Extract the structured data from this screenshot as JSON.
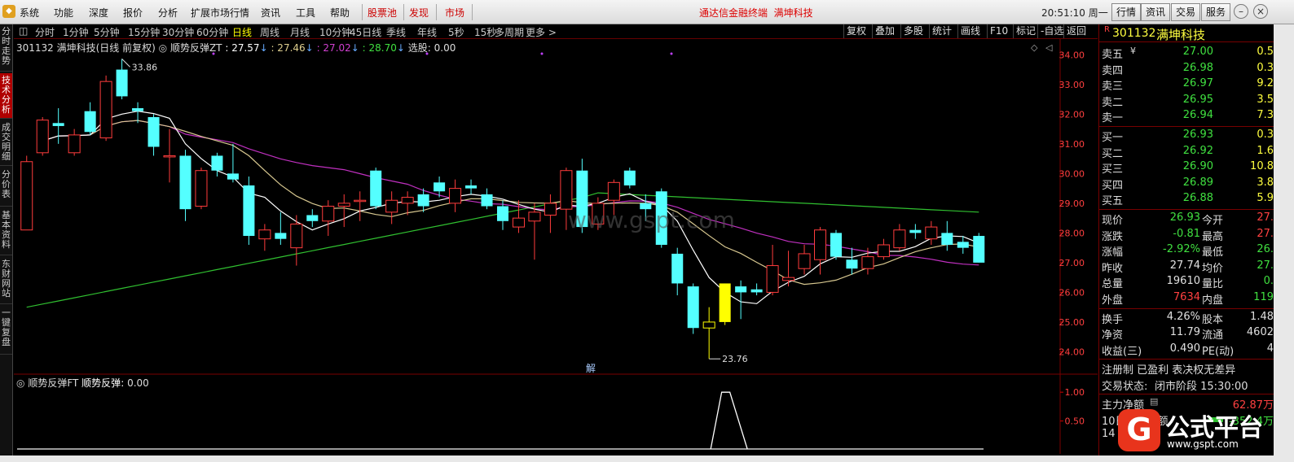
{
  "menu": {
    "logo": "logo",
    "items": [
      "系统",
      "功能",
      "深度",
      "报价",
      "分析",
      "扩展市场行情",
      "资讯",
      "工具",
      "帮助"
    ],
    "red_items": [
      "股票池",
      "发现",
      "市场"
    ],
    "company": "通达信金融终端",
    "company_name": "满坤科技",
    "clock": "20:51:10 周一",
    "tools": [
      "行情",
      "资讯",
      "交易",
      "服务"
    ]
  },
  "left_tabs": [
    "分时走势",
    "技术分析",
    "成交明细",
    "分价表",
    "基本资料",
    "东财网站",
    "一键复盘"
  ],
  "periods": [
    "分时",
    "1分钟",
    "5分钟",
    "15分钟",
    "30分钟",
    "60分钟",
    "日线",
    "周线",
    "月线",
    "10分钟",
    "45日线",
    "季线",
    "年线",
    "5秒",
    "15秒",
    "多周期",
    "更多 >"
  ],
  "active_period": "日线",
  "right_tools": [
    "复权",
    "叠加",
    "多股",
    "统计",
    "画线",
    "F10",
    "标记",
    "-自选",
    "返回"
  ],
  "info": {
    "title": "301132 满坤科技(日线 前复权)",
    "ind_name": "顺势反弹ZT",
    "v1": ": 27.57",
    "v2": ": 27.46",
    "v3": ": 27.02",
    "v4": ": 28.70",
    "xuangu": "选股: 0.00",
    "high_mark": "33.86",
    "low_mark": "23.76",
    "jie": "解",
    "watermark": "www.gspt.com"
  },
  "indicator": {
    "name": "顺势反弹FT",
    "label": "顺势反弹",
    "value": "0.00"
  },
  "chart_data": {
    "type": "candlestick",
    "ylim": [
      23.3,
      34.2
    ],
    "y_ticks": [
      "34.00",
      "33.00",
      "32.00",
      "31.00",
      "30.00",
      "29.00",
      "28.00",
      "27.00",
      "26.00",
      "25.00",
      "24.00"
    ],
    "candles": [
      {
        "o": 28.1,
        "h": 30.6,
        "l": 28.1,
        "c": 30.4
      },
      {
        "o": 30.7,
        "h": 31.9,
        "l": 30.6,
        "c": 31.8
      },
      {
        "o": 31.7,
        "h": 32.2,
        "l": 31.0,
        "c": 31.6
      },
      {
        "o": 30.7,
        "h": 31.5,
        "l": 30.6,
        "c": 31.3
      },
      {
        "o": 32.1,
        "h": 32.4,
        "l": 31.3,
        "c": 31.4
      },
      {
        "o": 31.2,
        "h": 33.3,
        "l": 31.1,
        "c": 33.1
      },
      {
        "o": 33.5,
        "h": 33.86,
        "l": 32.5,
        "c": 32.6
      },
      {
        "o": 32.2,
        "h": 32.4,
        "l": 31.7,
        "c": 32.1
      },
      {
        "o": 31.9,
        "h": 32.0,
        "l": 30.6,
        "c": 30.9
      },
      {
        "o": 30.6,
        "h": 31.5,
        "l": 29.7,
        "c": 30.6
      },
      {
        "o": 30.6,
        "h": 30.8,
        "l": 28.4,
        "c": 28.8
      },
      {
        "o": 28.9,
        "h": 30.2,
        "l": 28.8,
        "c": 30.1
      },
      {
        "o": 30.6,
        "h": 30.7,
        "l": 29.9,
        "c": 30.1
      },
      {
        "o": 30.0,
        "h": 31.0,
        "l": 29.7,
        "c": 29.8
      },
      {
        "o": 29.6,
        "h": 29.9,
        "l": 27.6,
        "c": 27.9
      },
      {
        "o": 27.8,
        "h": 28.3,
        "l": 27.4,
        "c": 28.1
      },
      {
        "o": 28.0,
        "h": 28.7,
        "l": 27.6,
        "c": 27.8
      },
      {
        "o": 27.5,
        "h": 28.6,
        "l": 26.9,
        "c": 28.3
      },
      {
        "o": 28.6,
        "h": 28.8,
        "l": 28.2,
        "c": 28.4
      },
      {
        "o": 28.4,
        "h": 29.1,
        "l": 27.9,
        "c": 28.9
      },
      {
        "o": 28.9,
        "h": 29.3,
        "l": 28.2,
        "c": 29.0
      },
      {
        "o": 29.1,
        "h": 29.4,
        "l": 28.4,
        "c": 29.1
      },
      {
        "o": 30.1,
        "h": 30.2,
        "l": 28.8,
        "c": 28.9
      },
      {
        "o": 28.7,
        "h": 29.4,
        "l": 28.3,
        "c": 29.1
      },
      {
        "o": 29.0,
        "h": 29.4,
        "l": 28.6,
        "c": 29.2
      },
      {
        "o": 29.3,
        "h": 29.5,
        "l": 28.7,
        "c": 28.9
      },
      {
        "o": 29.7,
        "h": 29.9,
        "l": 29.2,
        "c": 29.4
      },
      {
        "o": 29.0,
        "h": 29.8,
        "l": 28.7,
        "c": 29.5
      },
      {
        "o": 29.6,
        "h": 29.8,
        "l": 29.3,
        "c": 29.5
      },
      {
        "o": 29.3,
        "h": 29.5,
        "l": 28.8,
        "c": 28.9
      },
      {
        "o": 28.9,
        "h": 29.1,
        "l": 28.1,
        "c": 28.4
      },
      {
        "o": 28.2,
        "h": 29.1,
        "l": 28.0,
        "c": 28.5
      },
      {
        "o": 28.4,
        "h": 29.0,
        "l": 27.1,
        "c": 28.7
      },
      {
        "o": 28.6,
        "h": 29.3,
        "l": 28.0,
        "c": 29.0
      },
      {
        "o": 28.8,
        "h": 30.2,
        "l": 28.1,
        "c": 30.1
      },
      {
        "o": 30.1,
        "h": 30.5,
        "l": 28.0,
        "c": 28.2
      },
      {
        "o": 28.3,
        "h": 29.2,
        "l": 28.1,
        "c": 29.0
      },
      {
        "o": 29.1,
        "h": 29.8,
        "l": 28.6,
        "c": 29.7
      },
      {
        "o": 30.1,
        "h": 30.2,
        "l": 29.5,
        "c": 29.6
      },
      {
        "o": 29.0,
        "h": 29.3,
        "l": 28.4,
        "c": 28.8
      },
      {
        "o": 29.4,
        "h": 29.5,
        "l": 27.5,
        "c": 27.6
      },
      {
        "o": 27.3,
        "h": 27.5,
        "l": 25.9,
        "c": 26.3
      },
      {
        "o": 26.2,
        "h": 26.3,
        "l": 24.6,
        "c": 24.8
      },
      {
        "o": 24.8,
        "h": 25.5,
        "l": 23.76,
        "c": 25.0
      },
      {
        "o": 25.0,
        "h": 26.3,
        "l": 24.9,
        "c": 26.3
      },
      {
        "o": 26.2,
        "h": 26.4,
        "l": 25.1,
        "c": 26.0
      },
      {
        "o": 26.1,
        "h": 26.3,
        "l": 25.9,
        "c": 26.0
      },
      {
        "o": 26.0,
        "h": 27.6,
        "l": 25.9,
        "c": 26.9
      },
      {
        "o": 26.4,
        "h": 27.4,
        "l": 26.2,
        "c": 26.5
      },
      {
        "o": 26.8,
        "h": 27.6,
        "l": 26.6,
        "c": 27.3
      },
      {
        "o": 27.1,
        "h": 28.2,
        "l": 26.6,
        "c": 28.1
      },
      {
        "o": 28.0,
        "h": 28.1,
        "l": 27.1,
        "c": 27.2
      },
      {
        "o": 27.1,
        "h": 27.5,
        "l": 26.6,
        "c": 26.8
      },
      {
        "o": 26.8,
        "h": 27.5,
        "l": 26.6,
        "c": 27.2
      },
      {
        "o": 27.2,
        "h": 27.8,
        "l": 27.1,
        "c": 27.6
      },
      {
        "o": 27.5,
        "h": 28.3,
        "l": 27.4,
        "c": 28.1
      },
      {
        "o": 28.1,
        "h": 28.3,
        "l": 27.8,
        "c": 28.0
      },
      {
        "o": 27.8,
        "h": 28.4,
        "l": 27.6,
        "c": 28.2
      },
      {
        "o": 28.0,
        "h": 28.4,
        "l": 27.4,
        "c": 27.6
      },
      {
        "o": 27.7,
        "h": 27.9,
        "l": 27.3,
        "c": 27.5
      },
      {
        "o": 27.9,
        "h": 28.0,
        "l": 27.0,
        "c": 27.0
      }
    ],
    "indicator_signal": {
      "ylim": [
        0,
        1.2
      ],
      "ticks": [
        "1.00",
        "0.50"
      ],
      "pulse_index": 44
    },
    "colors": {
      "up": "#ff3c3c",
      "down": "#54ffff",
      "highlight": "#ffff00",
      "ma_white": "#ffffff",
      "ma_tan": "#d8c890",
      "ma_purple": "#c030c0",
      "ma_green": "#30c030",
      "grid": "#7a0000"
    }
  },
  "quote": {
    "code": "301132",
    "name": "满坤科技",
    "r_mark": "R",
    "yuan": "¥",
    "asks": [
      {
        "label": "卖五",
        "price": "27.00",
        "vol": "0.5"
      },
      {
        "label": "卖四",
        "price": "26.98",
        "vol": "0.3"
      },
      {
        "label": "卖三",
        "price": "26.97",
        "vol": "9.2"
      },
      {
        "label": "卖二",
        "price": "26.95",
        "vol": "3.5"
      },
      {
        "label": "卖一",
        "price": "26.94",
        "vol": "7.3"
      }
    ],
    "bids": [
      {
        "label": "买一",
        "price": "26.93",
        "vol": "0.3"
      },
      {
        "label": "买二",
        "price": "26.92",
        "vol": "1.6"
      },
      {
        "label": "买三",
        "price": "26.90",
        "vol": "10.8"
      },
      {
        "label": "买四",
        "price": "26.89",
        "vol": "3.8"
      },
      {
        "label": "买五",
        "price": "26.88",
        "vol": "5.9"
      }
    ],
    "stats": [
      {
        "l1": "现价",
        "v1": "26.93",
        "c1": "dn",
        "l2": "今开",
        "v2": "27.",
        "c2": "up"
      },
      {
        "l1": "涨跌",
        "v1": "-0.81",
        "c1": "dn",
        "l2": "最高",
        "v2": "27.",
        "c2": "up"
      },
      {
        "l1": "涨幅",
        "v1": "-2.92%",
        "c1": "dn",
        "l2": "最低",
        "v2": "26.",
        "c2": "dn"
      },
      {
        "l1": "昨收",
        "v1": "27.74",
        "c1": "wh",
        "l2": "均价",
        "v2": "27.",
        "c2": "dn"
      },
      {
        "l1": "总量",
        "v1": "19610",
        "c1": "wh",
        "l2": "量比",
        "v2": "0.",
        "c2": "dn"
      },
      {
        "l1": "外盘",
        "v1": "7634",
        "c1": "up",
        "l2": "内盘",
        "v2": "119",
        "c2": "dn"
      }
    ],
    "stats2": [
      {
        "l1": "换手",
        "v1": "4.26%",
        "l2": "股本",
        "v2": "1.48"
      },
      {
        "l1": "净资",
        "v1": "11.79",
        "l2": "流通",
        "v2": "4602"
      },
      {
        "l1": "收益(三)",
        "v1": "0.490",
        "l2": "PE(动)",
        "v2": "4"
      }
    ],
    "reg": "注册制 已盈利 表决权无差异",
    "state_label": "交易状态:",
    "state_value": "闭市阶段 15:30:00",
    "flow1_label": "主力净额",
    "flow1_value": "62.87万",
    "flow2_label": "10日主力净额",
    "flow2_value": "-352.4万",
    "flow_bar_value": 0.35,
    "extra": "14"
  },
  "brand": {
    "g": "G",
    "name": "公式平台",
    "url": "www.gspt.com"
  }
}
